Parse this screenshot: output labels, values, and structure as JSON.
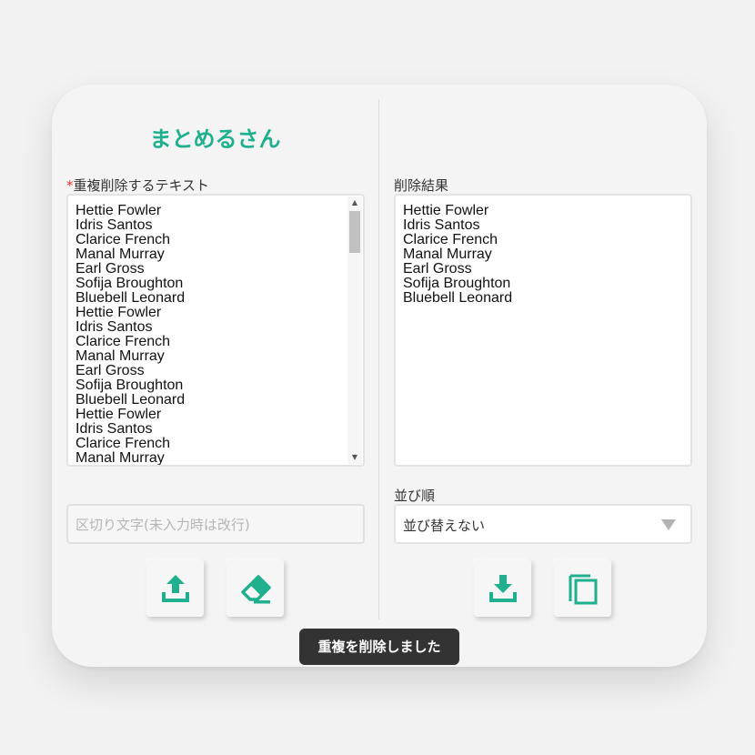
{
  "app": {
    "title": "まとめるさん"
  },
  "input_panel": {
    "required_mark": "*",
    "label": "重複削除するテキスト",
    "lines": [
      "Hettie Fowler",
      "Idris Santos",
      "Clarice French",
      "Manal Murray",
      "Earl Gross",
      "Sofija Broughton",
      "Bluebell Leonard",
      "Hettie Fowler",
      "Idris Santos",
      "Clarice French",
      "Manal Murray",
      "Earl Gross",
      "Sofija Broughton",
      "Bluebell Leonard",
      "Hettie Fowler",
      "Idris Santos",
      "Clarice French",
      "Manal Murray"
    ],
    "delimiter_placeholder": "区切り文字(未入力時は改行)"
  },
  "result_panel": {
    "label": "削除結果",
    "lines": [
      "Hettie Fowler",
      "Idris Santos",
      "Clarice French",
      "Manal Murray",
      "Earl Gross",
      "Sofija Broughton",
      "Bluebell Leonard"
    ],
    "sort_label": "並び順",
    "sort_value": "並び替えない"
  },
  "buttons": {
    "upload_icon": "upload-icon",
    "clear_icon": "eraser-icon",
    "download_icon": "download-icon",
    "copy_icon": "copy-icon"
  },
  "toast": {
    "message": "重複を削除しました"
  },
  "colors": {
    "accent": "#1fb08d",
    "toast_bg": "#333333"
  }
}
